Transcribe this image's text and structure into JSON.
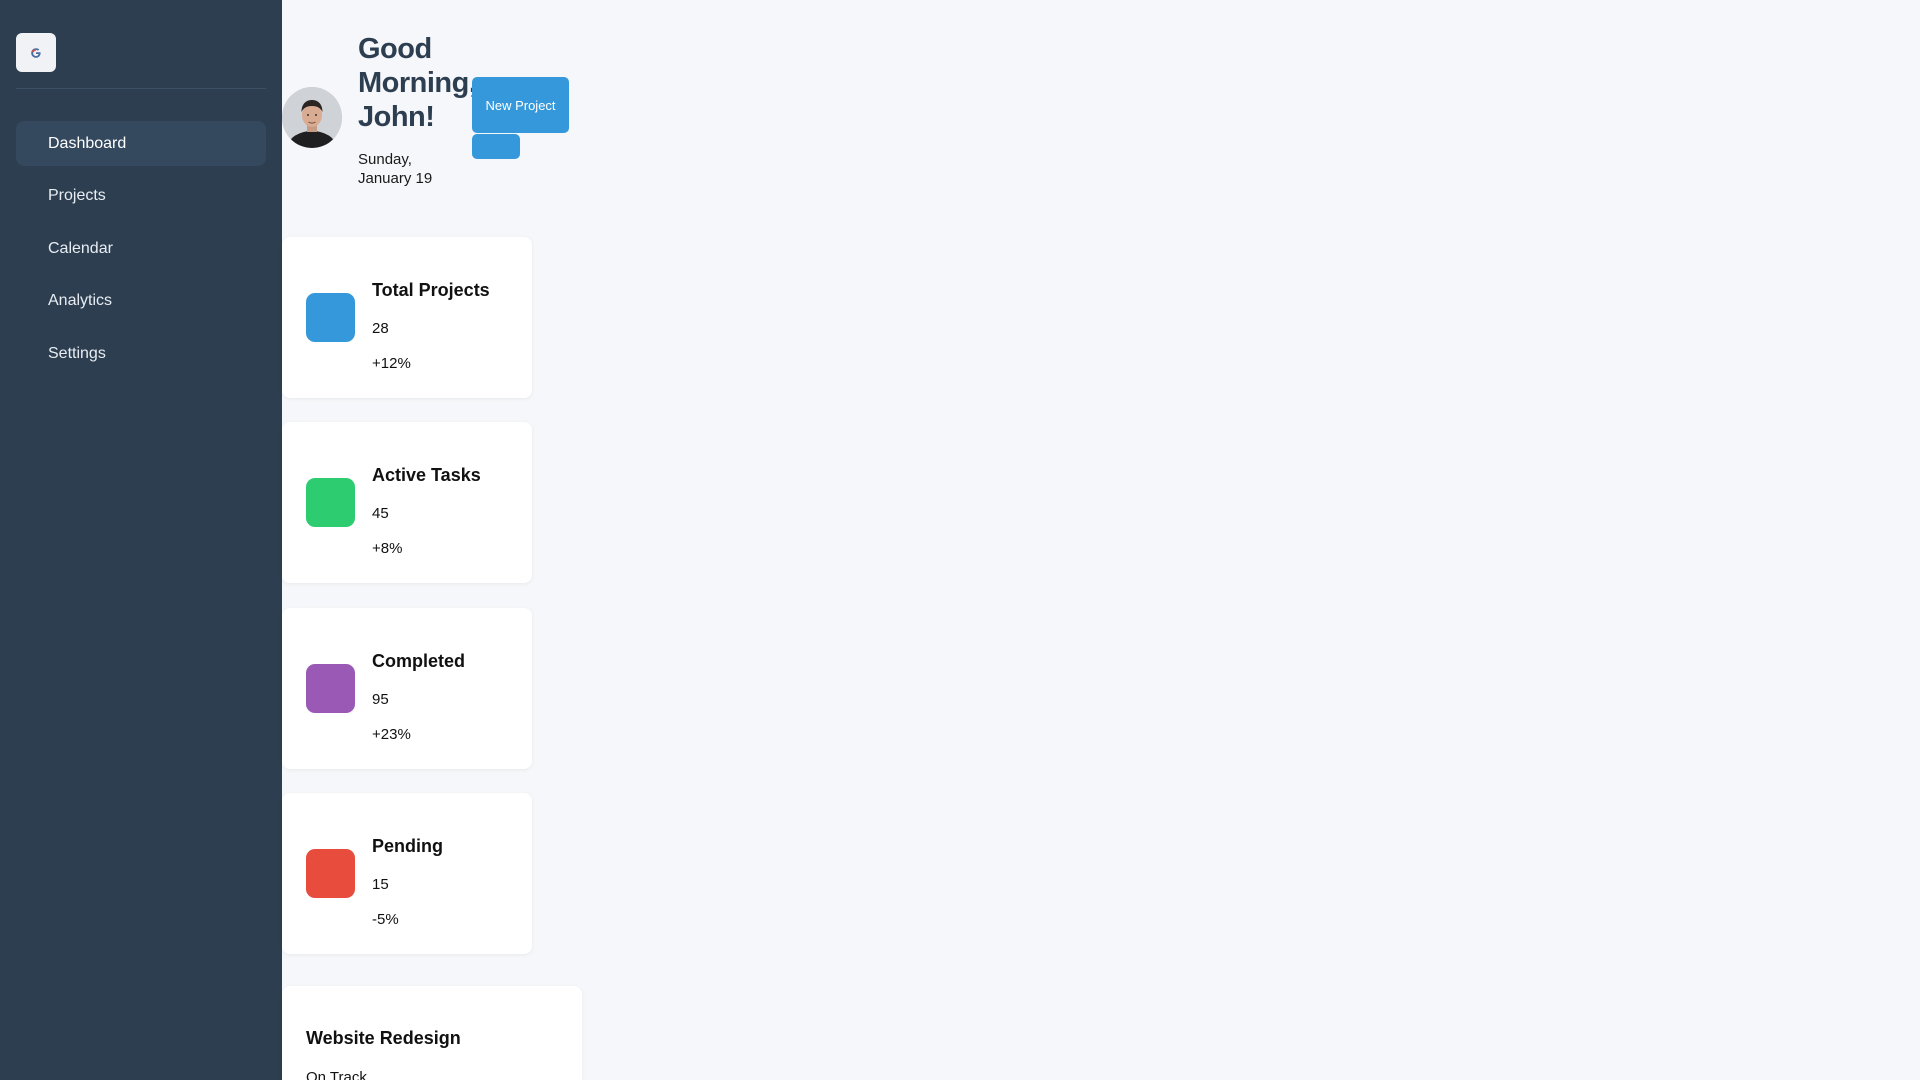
{
  "sidebar": {
    "logo_icon": "g-logo-icon",
    "items": [
      {
        "label": "Dashboard",
        "active": true
      },
      {
        "label": "Projects",
        "active": false
      },
      {
        "label": "Calendar",
        "active": false
      },
      {
        "label": "Analytics",
        "active": false
      },
      {
        "label": "Settings",
        "active": false
      }
    ]
  },
  "header": {
    "greeting": "Good Morning, John!",
    "date": "Sunday, January 19",
    "new_project_label": "New Project",
    "secondary_button_label": ""
  },
  "stats": [
    {
      "title": "Total Projects",
      "value": "28",
      "change": "+12%",
      "color": "#3498db"
    },
    {
      "title": "Active Tasks",
      "value": "45",
      "change": "+8%",
      "color": "#2ecc71"
    },
    {
      "title": "Completed",
      "value": "95",
      "change": "+23%",
      "color": "#9b59b6"
    },
    {
      "title": "Pending",
      "value": "15",
      "change": "-5%",
      "color": "#e74c3c"
    }
  ],
  "project": {
    "title": "Website Redesign",
    "status": "On Track"
  },
  "colors": {
    "sidebar_bg": "#2c3e50",
    "sidebar_active": "#34495e",
    "accent": "#3498db",
    "page_bg": "#f5f7fa"
  }
}
